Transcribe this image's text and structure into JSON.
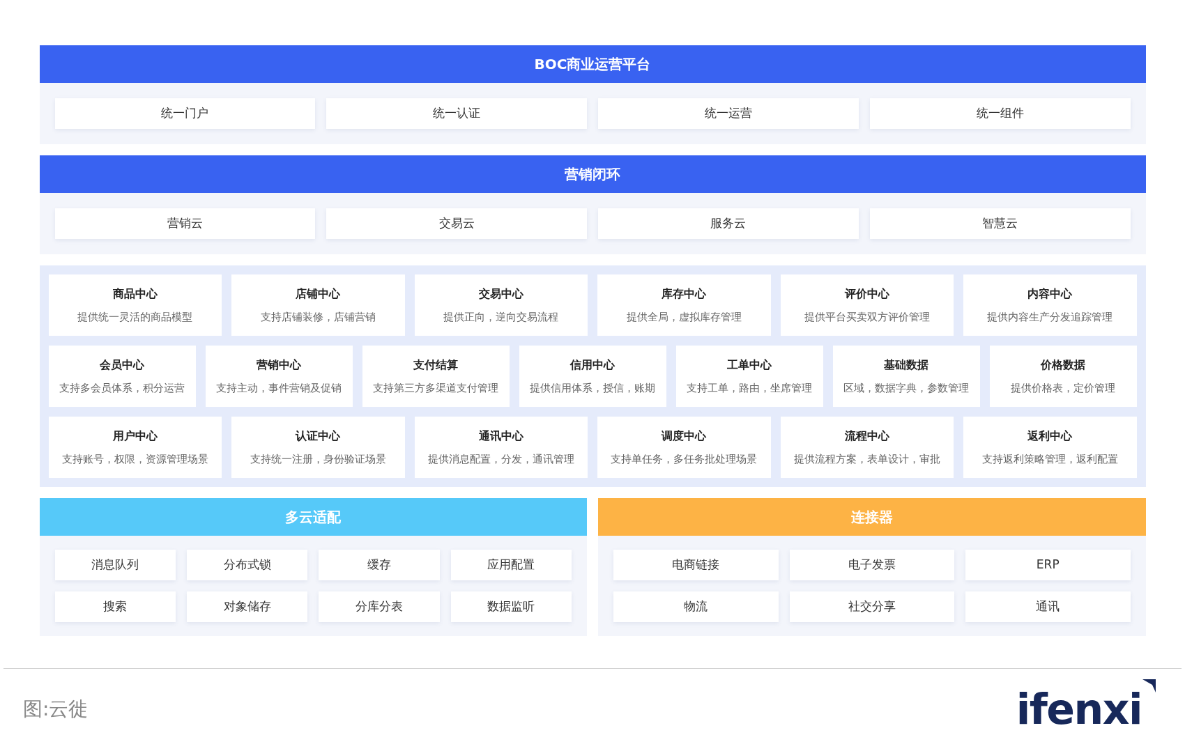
{
  "sections": [
    {
      "title": "BOC商业运营平台",
      "color": "#3962f1",
      "items": [
        "统一门户",
        "统一认证",
        "统一运营",
        "统一组件"
      ]
    },
    {
      "title": "营销闭环",
      "color": "#3962f1",
      "items": [
        "营销云",
        "交易云",
        "服务云",
        "智慧云"
      ]
    }
  ],
  "centers": [
    [
      {
        "name": "商品中心",
        "desc": "提供统一灵活的商品模型"
      },
      {
        "name": "店铺中心",
        "desc": "支持店铺装修，店铺营销"
      },
      {
        "name": "交易中心",
        "desc": "提供正向，逆向交易流程"
      },
      {
        "name": "库存中心",
        "desc": "提供全局，虚拟库存管理"
      },
      {
        "name": "评价中心",
        "desc": "提供平台买卖双方评价管理"
      },
      {
        "name": "内容中心",
        "desc": "提供内容生产分发追踪管理"
      }
    ],
    [
      {
        "name": "会员中心",
        "desc": "支持多会员体系，积分运营"
      },
      {
        "name": "营销中心",
        "desc": "支持主动，事件营销及促销"
      },
      {
        "name": "支付结算",
        "desc": "支持第三方多渠道支付管理"
      },
      {
        "name": "信用中心",
        "desc": "提供信用体系，授信，账期"
      },
      {
        "name": "工单中心",
        "desc": "支持工单，路由，坐席管理"
      },
      {
        "name": "基础数据",
        "desc": "区域，数据字典，参数管理"
      },
      {
        "name": "价格数据",
        "desc": "提供价格表，定价管理"
      }
    ],
    [
      {
        "name": "用户中心",
        "desc": "支持账号，权限，资源管理场景"
      },
      {
        "name": "认证中心",
        "desc": "支持统一注册，身份验证场景"
      },
      {
        "name": "通讯中心",
        "desc": "提供消息配置，分发，通讯管理"
      },
      {
        "name": "调度中心",
        "desc": "支持单任务，多任务批处理场景"
      },
      {
        "name": "流程中心",
        "desc": "提供流程方案，表单设计，审批"
      },
      {
        "name": "返利中心",
        "desc": "支持返利策略管理，返利配置"
      }
    ]
  ],
  "bottom": [
    {
      "title": "多云适配",
      "color": "#56c9f9",
      "items": [
        "消息队列",
        "分布式锁",
        "缓存",
        "应用配置",
        "搜索",
        "对象储存",
        "分库分表",
        "数据监听"
      ]
    },
    {
      "title": "连接器",
      "color": "#fdb345",
      "items": [
        "电商链接",
        "电子发票",
        "ERP",
        "物流",
        "社交分享",
        "通讯"
      ]
    }
  ],
  "caption": "图:云徙",
  "logo": "ifenxi"
}
